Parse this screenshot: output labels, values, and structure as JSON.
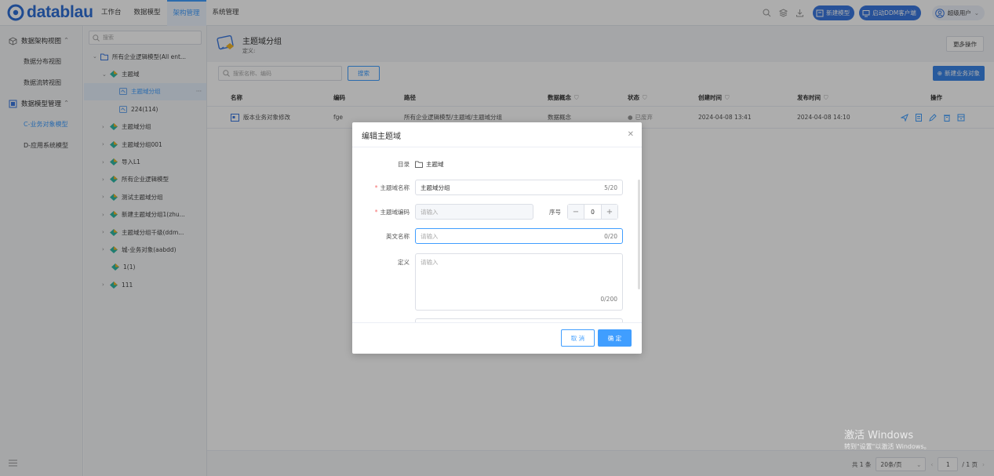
{
  "app": {
    "brand": "datablau"
  },
  "nav": [
    "工作台",
    "数据模型",
    "架构管理",
    "系统管理"
  ],
  "toolbar": {
    "new_model": "新建模型",
    "ddm_client": "启动DDM客户端",
    "user": "超级用户"
  },
  "sidebar": {
    "section1": "数据架构视图",
    "items1": [
      "数据分布视图",
      "数据流转视图"
    ],
    "section2": "数据模型管理",
    "items2": [
      "C-业务对象模型",
      "D-应用系统模型"
    ]
  },
  "tree": {
    "search_placeholder": "搜索",
    "nodes": [
      "所有企业逻辑模型(All ent...",
      "主题域",
      "主题域分组",
      "224(114)",
      "主题域分组",
      "主题域分组001",
      "导入L1",
      "所有企业逻辑模型",
      "测试主题域分组",
      "新建主题域分组1(zhu...",
      "主题域分组千级(ddm...",
      "城-业务对象(aabdd)",
      "1(1)",
      "111"
    ],
    "more": "···"
  },
  "main": {
    "title": "主题域分组",
    "definition": "定义:",
    "more_ops": "更多操作",
    "search_placeholder": "搜索名称、编码",
    "search_btn": "搜索",
    "new_btn": "新建业务对象",
    "columns": [
      "名称",
      "编码",
      "路径",
      "数据概念",
      "状态",
      "创建时间",
      "发布时间",
      "操作"
    ],
    "row": {
      "name": "版本业务对象修改",
      "code": "fge",
      "path": "所有企业逻辑模型/主题域/主题域分组",
      "concept": "数据概念",
      "status": "已废弃",
      "created": "2024-04-08 13:41",
      "published": "2024-04-08 14:10"
    }
  },
  "pagination": {
    "total": "共 1 条",
    "page_size": "20条/页",
    "page": "1",
    "pages": "/ 1 页"
  },
  "modal": {
    "title": "编辑主题域",
    "dir_label": "目录",
    "dir_value": "主题域",
    "name_label": "主题域名称",
    "name_value": "主题域分组",
    "name_count": "5/20",
    "code_label": "主题域编码",
    "code_placeholder": "请输入",
    "seq_label": "序号",
    "seq_value": "0",
    "en_label": "英文名称",
    "en_placeholder": "请输入",
    "en_count": "0/20",
    "def_label": "定义",
    "def_placeholder": "请输入",
    "def_count": "0/200",
    "cancel": "取 消",
    "ok": "确 定"
  },
  "watermark": {
    "line1": "激活 Windows",
    "line2": "转到\"设置\"以激活 Windows。"
  },
  "colors": {
    "primary": "#409eff",
    "brand": "#2f6fd6"
  }
}
